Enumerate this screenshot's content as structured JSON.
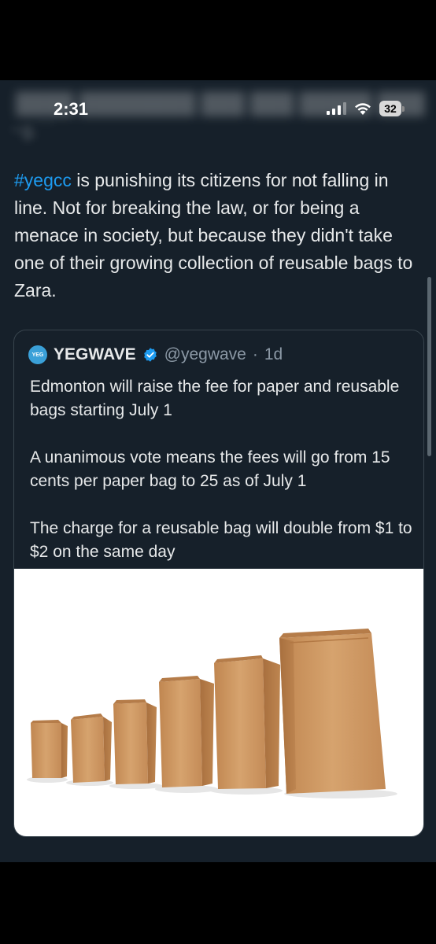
{
  "status_bar": {
    "time": "2:31",
    "battery": "32",
    "icons": [
      "signal-icon",
      "wifi-icon",
      "battery-icon"
    ]
  },
  "tweet": {
    "hashtag": "#yegcc",
    "text": " is punishing its citizens for not falling in line. Not for breaking the law, or for being a menace in society, but because they didn't take one of their growing collection of reusable bags to Zara."
  },
  "quote": {
    "display_name": "YEGWAVE",
    "handle": "@yegwave",
    "separator": "·",
    "time": "1d",
    "paragraphs": [
      "Edmonton will raise the fee for paper and reusable bags starting July 1",
      "A unanimous vote means the fees will go from 15 cents per paper bag to 25 as of July 1",
      "The charge for a reusable bag will double from $1 to $2 on the same day"
    ],
    "image_subject": "paper-bags-image"
  },
  "colors": {
    "background": "#16202a",
    "text": "#e7e9ea",
    "link": "#1d9bf0",
    "muted": "#8b98a5",
    "border": "#38444d",
    "bag": "#c8935e"
  }
}
